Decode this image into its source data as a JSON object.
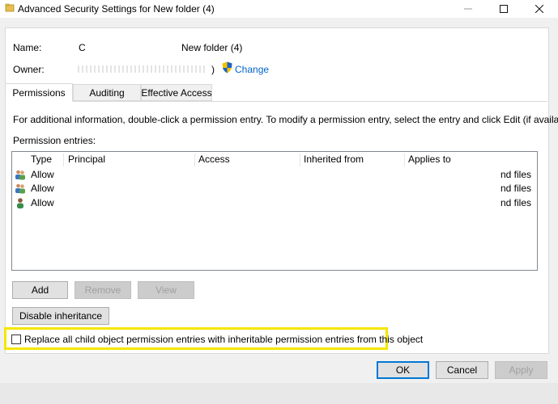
{
  "window": {
    "title": "Advanced Security Settings for New folder (4)",
    "minimize_icon": "minimize-icon",
    "maximize_icon": "maximize-icon",
    "close_icon": "close-icon"
  },
  "header": {
    "name_label": "Name:",
    "name_value_fragment_1": "C",
    "name_value_fragment_2": "New folder (4)",
    "owner_label": "Owner:",
    "owner_value_fragment": ")",
    "change_link": "Change"
  },
  "tabs": [
    {
      "label": "Permissions",
      "active": true
    },
    {
      "label": "Auditing",
      "active": false
    },
    {
      "label": "Effective Access",
      "active": false
    }
  ],
  "info_text": "For additional information, double-click a permission entry. To modify a permission entry, select the entry and click Edit (if available).",
  "entries_label": "Permission entries:",
  "table": {
    "columns": [
      "Type",
      "Principal",
      "Access",
      "Inherited from",
      "Applies to"
    ],
    "rows": [
      {
        "icon": "group-users-icon",
        "type": "Allow",
        "applies_to": "nd files"
      },
      {
        "icon": "group-users-icon",
        "type": "Allow",
        "applies_to": "nd files"
      },
      {
        "icon": "user-icon",
        "type": "Allow",
        "applies_to": "nd files"
      }
    ]
  },
  "buttons": {
    "add": "Add",
    "remove": "Remove",
    "view": "View",
    "disable_inheritance": "Disable inheritance",
    "ok": "OK",
    "cancel": "Cancel",
    "apply": "Apply"
  },
  "replace_checkbox": {
    "label": "Replace all child object permission entries with inheritable permission entries from this object",
    "checked": false
  },
  "colors": {
    "highlight": "#f5e600",
    "link": "#0066cc",
    "accent": "#0078d7"
  }
}
